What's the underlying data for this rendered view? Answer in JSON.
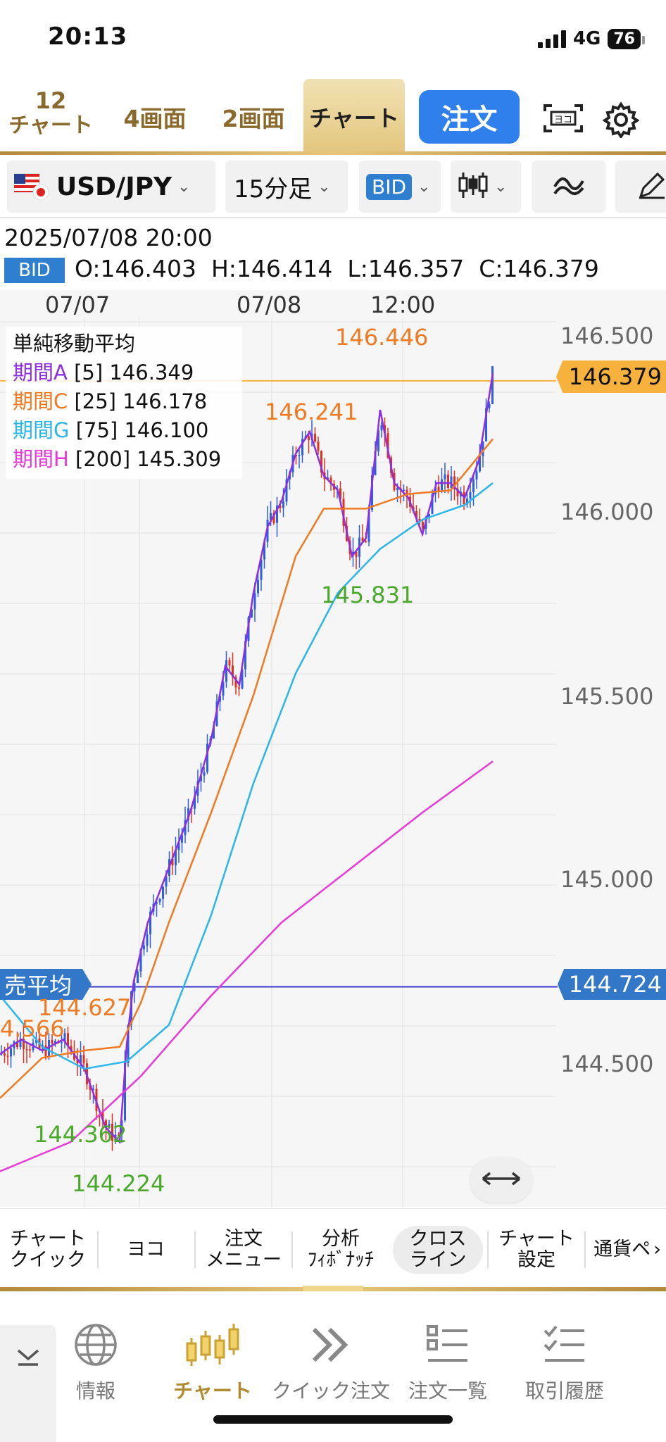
{
  "status_bar": {
    "time": "20:13",
    "network": "4G",
    "battery": "76"
  },
  "top_nav": {
    "chart_count_num": "12",
    "chart_count_label": "チャート",
    "four_screen": "4画面",
    "two_screen": "2画面",
    "chart_tab": "チャート",
    "order_button": "注文"
  },
  "toolbar": {
    "pair": "USD/JPY",
    "timeframe": "15分足",
    "price_type": "BID"
  },
  "ohlc": {
    "datetime": "2025/07/08 20:00",
    "badge": "BID",
    "values": "O:146.403  H:146.414  L:146.357  C:146.379"
  },
  "chart": {
    "date_labels": [
      "07/07",
      "07/08",
      "12:00"
    ],
    "legend_title": "単純移動平均",
    "ma": [
      {
        "name": "期間A",
        "period": "[5]",
        "value": "146.349",
        "color": "#8b2fe0"
      },
      {
        "name": "期間C",
        "period": "[25]",
        "value": "146.178",
        "color": "#f07a22"
      },
      {
        "name": "期間G",
        "period": "[75]",
        "value": "146.100",
        "color": "#2bb6ea"
      },
      {
        "name": "期間H",
        "period": "[200]",
        "value": "145.309",
        "color": "#e83ad8"
      }
    ],
    "price_axis": [
      "146.500",
      "146.000",
      "145.500",
      "145.000",
      "144.500"
    ],
    "current_price": "146.379",
    "avg_line_label": "売平均",
    "avg_line_price": "144.724",
    "annotations": {
      "high": "146.446",
      "mid_high": "146.241",
      "mid_low": "145.831",
      "left_1": "144.627",
      "left_2": "4.566",
      "low_1": "144.362",
      "low_2": "144.224"
    },
    "colors": {
      "up": "#2f5fe0",
      "down": "#e0301e",
      "avg_line": "#3a3acf",
      "price_tag": "#f7b23e",
      "avg_tag": "#3277c8"
    }
  },
  "bottom_toolbar": {
    "items": [
      "チャート\nクイック",
      "ヨコ",
      "注文\nメニュー",
      "分析\nﾌｨﾎﾞﾅｯﾁ",
      "クロス\nライン",
      "チャート\n設定",
      "通貨ペ"
    ]
  },
  "tab_bar": {
    "tabs": [
      "情報",
      "チャート",
      "クイック注文",
      "注文一覧",
      "取引履歴"
    ]
  }
}
